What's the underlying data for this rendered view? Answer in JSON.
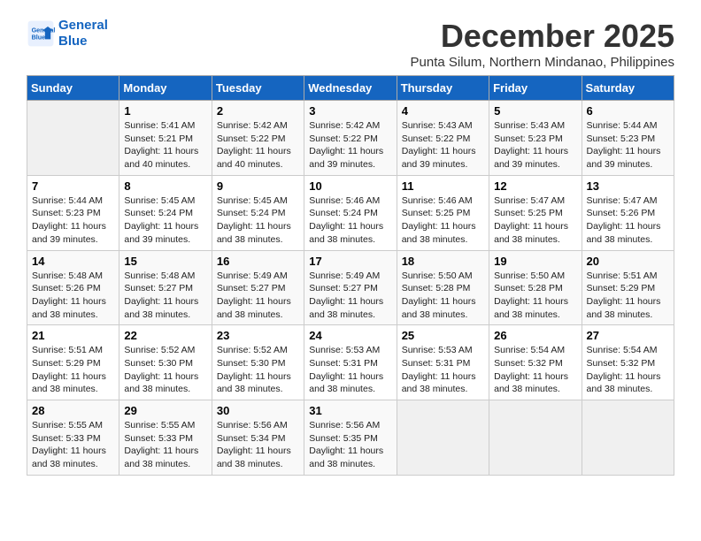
{
  "logo": {
    "line1": "General",
    "line2": "Blue"
  },
  "title": "December 2025",
  "location": "Punta Silum, Northern Mindanao, Philippines",
  "weekdays": [
    "Sunday",
    "Monday",
    "Tuesday",
    "Wednesday",
    "Thursday",
    "Friday",
    "Saturday"
  ],
  "weeks": [
    [
      {
        "day": "",
        "sunrise": "",
        "sunset": "",
        "daylight": ""
      },
      {
        "day": "1",
        "sunrise": "Sunrise: 5:41 AM",
        "sunset": "Sunset: 5:21 PM",
        "daylight": "Daylight: 11 hours and 40 minutes."
      },
      {
        "day": "2",
        "sunrise": "Sunrise: 5:42 AM",
        "sunset": "Sunset: 5:22 PM",
        "daylight": "Daylight: 11 hours and 40 minutes."
      },
      {
        "day": "3",
        "sunrise": "Sunrise: 5:42 AM",
        "sunset": "Sunset: 5:22 PM",
        "daylight": "Daylight: 11 hours and 39 minutes."
      },
      {
        "day": "4",
        "sunrise": "Sunrise: 5:43 AM",
        "sunset": "Sunset: 5:22 PM",
        "daylight": "Daylight: 11 hours and 39 minutes."
      },
      {
        "day": "5",
        "sunrise": "Sunrise: 5:43 AM",
        "sunset": "Sunset: 5:23 PM",
        "daylight": "Daylight: 11 hours and 39 minutes."
      },
      {
        "day": "6",
        "sunrise": "Sunrise: 5:44 AM",
        "sunset": "Sunset: 5:23 PM",
        "daylight": "Daylight: 11 hours and 39 minutes."
      }
    ],
    [
      {
        "day": "7",
        "sunrise": "Sunrise: 5:44 AM",
        "sunset": "Sunset: 5:23 PM",
        "daylight": "Daylight: 11 hours and 39 minutes."
      },
      {
        "day": "8",
        "sunrise": "Sunrise: 5:45 AM",
        "sunset": "Sunset: 5:24 PM",
        "daylight": "Daylight: 11 hours and 39 minutes."
      },
      {
        "day": "9",
        "sunrise": "Sunrise: 5:45 AM",
        "sunset": "Sunset: 5:24 PM",
        "daylight": "Daylight: 11 hours and 38 minutes."
      },
      {
        "day": "10",
        "sunrise": "Sunrise: 5:46 AM",
        "sunset": "Sunset: 5:24 PM",
        "daylight": "Daylight: 11 hours and 38 minutes."
      },
      {
        "day": "11",
        "sunrise": "Sunrise: 5:46 AM",
        "sunset": "Sunset: 5:25 PM",
        "daylight": "Daylight: 11 hours and 38 minutes."
      },
      {
        "day": "12",
        "sunrise": "Sunrise: 5:47 AM",
        "sunset": "Sunset: 5:25 PM",
        "daylight": "Daylight: 11 hours and 38 minutes."
      },
      {
        "day": "13",
        "sunrise": "Sunrise: 5:47 AM",
        "sunset": "Sunset: 5:26 PM",
        "daylight": "Daylight: 11 hours and 38 minutes."
      }
    ],
    [
      {
        "day": "14",
        "sunrise": "Sunrise: 5:48 AM",
        "sunset": "Sunset: 5:26 PM",
        "daylight": "Daylight: 11 hours and 38 minutes."
      },
      {
        "day": "15",
        "sunrise": "Sunrise: 5:48 AM",
        "sunset": "Sunset: 5:27 PM",
        "daylight": "Daylight: 11 hours and 38 minutes."
      },
      {
        "day": "16",
        "sunrise": "Sunrise: 5:49 AM",
        "sunset": "Sunset: 5:27 PM",
        "daylight": "Daylight: 11 hours and 38 minutes."
      },
      {
        "day": "17",
        "sunrise": "Sunrise: 5:49 AM",
        "sunset": "Sunset: 5:27 PM",
        "daylight": "Daylight: 11 hours and 38 minutes."
      },
      {
        "day": "18",
        "sunrise": "Sunrise: 5:50 AM",
        "sunset": "Sunset: 5:28 PM",
        "daylight": "Daylight: 11 hours and 38 minutes."
      },
      {
        "day": "19",
        "sunrise": "Sunrise: 5:50 AM",
        "sunset": "Sunset: 5:28 PM",
        "daylight": "Daylight: 11 hours and 38 minutes."
      },
      {
        "day": "20",
        "sunrise": "Sunrise: 5:51 AM",
        "sunset": "Sunset: 5:29 PM",
        "daylight": "Daylight: 11 hours and 38 minutes."
      }
    ],
    [
      {
        "day": "21",
        "sunrise": "Sunrise: 5:51 AM",
        "sunset": "Sunset: 5:29 PM",
        "daylight": "Daylight: 11 hours and 38 minutes."
      },
      {
        "day": "22",
        "sunrise": "Sunrise: 5:52 AM",
        "sunset": "Sunset: 5:30 PM",
        "daylight": "Daylight: 11 hours and 38 minutes."
      },
      {
        "day": "23",
        "sunrise": "Sunrise: 5:52 AM",
        "sunset": "Sunset: 5:30 PM",
        "daylight": "Daylight: 11 hours and 38 minutes."
      },
      {
        "day": "24",
        "sunrise": "Sunrise: 5:53 AM",
        "sunset": "Sunset: 5:31 PM",
        "daylight": "Daylight: 11 hours and 38 minutes."
      },
      {
        "day": "25",
        "sunrise": "Sunrise: 5:53 AM",
        "sunset": "Sunset: 5:31 PM",
        "daylight": "Daylight: 11 hours and 38 minutes."
      },
      {
        "day": "26",
        "sunrise": "Sunrise: 5:54 AM",
        "sunset": "Sunset: 5:32 PM",
        "daylight": "Daylight: 11 hours and 38 minutes."
      },
      {
        "day": "27",
        "sunrise": "Sunrise: 5:54 AM",
        "sunset": "Sunset: 5:32 PM",
        "daylight": "Daylight: 11 hours and 38 minutes."
      }
    ],
    [
      {
        "day": "28",
        "sunrise": "Sunrise: 5:55 AM",
        "sunset": "Sunset: 5:33 PM",
        "daylight": "Daylight: 11 hours and 38 minutes."
      },
      {
        "day": "29",
        "sunrise": "Sunrise: 5:55 AM",
        "sunset": "Sunset: 5:33 PM",
        "daylight": "Daylight: 11 hours and 38 minutes."
      },
      {
        "day": "30",
        "sunrise": "Sunrise: 5:56 AM",
        "sunset": "Sunset: 5:34 PM",
        "daylight": "Daylight: 11 hours and 38 minutes."
      },
      {
        "day": "31",
        "sunrise": "Sunrise: 5:56 AM",
        "sunset": "Sunset: 5:35 PM",
        "daylight": "Daylight: 11 hours and 38 minutes."
      },
      {
        "day": "",
        "sunrise": "",
        "sunset": "",
        "daylight": ""
      },
      {
        "day": "",
        "sunrise": "",
        "sunset": "",
        "daylight": ""
      },
      {
        "day": "",
        "sunrise": "",
        "sunset": "",
        "daylight": ""
      }
    ]
  ]
}
